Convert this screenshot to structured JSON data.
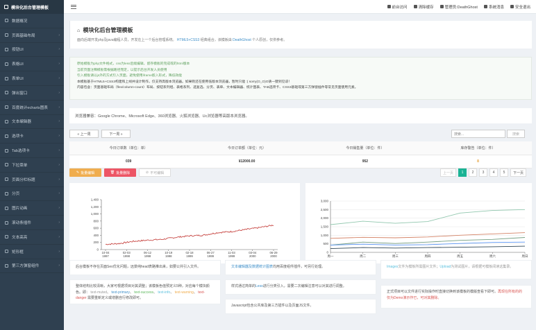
{
  "brand": "模块化后台管理模板",
  "sidebar": {
    "items": [
      {
        "label": "数据概况",
        "arrow": ""
      },
      {
        "label": "页面基础布局",
        "arrow": "›"
      },
      {
        "label": "按钮UI",
        "arrow": "›"
      },
      {
        "label": "表格UI",
        "arrow": "›"
      },
      {
        "label": "表单UI",
        "arrow": "›"
      },
      {
        "label": "弹出窗口",
        "arrow": "›"
      },
      {
        "label": "百度统计echarts图表",
        "arrow": "›"
      },
      {
        "label": "文本编辑器",
        "arrow": "›"
      },
      {
        "label": "选项卡",
        "arrow": "›"
      },
      {
        "label": "Tab选项卡",
        "arrow": "›"
      },
      {
        "label": "下拉菜单",
        "arrow": "›"
      },
      {
        "label": "页面分栏标题",
        "arrow": "›"
      },
      {
        "label": "分页",
        "arrow": "›"
      },
      {
        "label": "图片动画",
        "arrow": "›"
      },
      {
        "label": "滚动条插件",
        "arrow": "›"
      },
      {
        "label": "文本高亮",
        "arrow": "›"
      },
      {
        "label": "矩形框",
        "arrow": "›"
      },
      {
        "label": "第三方弹窗组件",
        "arrow": "›"
      }
    ]
  },
  "topbar": {
    "links": [
      {
        "label": "前台访问",
        "icon": "home-icon"
      },
      {
        "label": "清除缓存",
        "icon": "refresh-icon"
      },
      {
        "label": "管理员:DeathGhost",
        "icon": "user-icon"
      },
      {
        "label": "系统消息",
        "icon": "bell-icon"
      },
      {
        "label": "安全退出",
        "icon": "logout-icon"
      }
    ]
  },
  "header": {
    "title": "模块化后台管理模板",
    "desc_before": "面向后端开发php及java编程人员，开发在上一个后台管理系统。",
    "desc_hl1": "HTML5+CSS3",
    "desc_mid": "经典组合，该模板由",
    "desc_hl2": "DeathGhost",
    "desc_after": "个人原创，仅供参考。"
  },
  "notice": {
    "lines": [
      {
        "text": "原始模板为php文件格式，css为less后缀编辑，留存模板的完成或的html版本",
        "cls": "g"
      },
      {
        "text": "当前页面注释模板需根据路径而定，以提示后台开发人员使用",
        "cls": "g"
      },
      {
        "text": "引入模板请以js外的方式引入页面，避免使用iframe嵌入形式，降低效能",
        "cls": "g"
      },
      {
        "text": "本模板基于HTML5+CSS3构建和上线并设计制作，仅支持高版本浏览器。如果则还在使用低版本浏览器，暂时只能 :( sorry(O_O)O请一键到见谅！",
        "cls": "d"
      },
      {
        "text": "内容包含：页面基础布局（flex/column-count）布局、按钮系列组、表格系列、选复选、分页、表单、文本编辑器、统计图表、TAB选项卡、CSS3基础或第三方弹窗插件等常见页面使用元素。",
        "cls": "d"
      }
    ]
  },
  "browsers": "浏览器兼容：Google Chrome、Microsoft Edge、360浏览器、火狐浏览器、Uc浏览器等高版本浏览器。",
  "toolbar": {
    "prev": "« 上一周",
    "next": "下一周 »",
    "search_placeholder": "搜索...",
    "search_btn": "搜索"
  },
  "stats": {
    "headers": [
      "今日订单数（单位：单）",
      "今日订单额（单位：元）",
      "今日销售量（单位：件）",
      "库存警告（单位：件）"
    ],
    "values": [
      "039",
      "¥12000.00",
      "952",
      "8"
    ]
  },
  "actions": {
    "batch_edit": "批量编辑",
    "batch_delete": "批量删除",
    "no_edit": "不可编辑"
  },
  "pagination": {
    "prev": "上一页",
    "pages": [
      "1",
      "2",
      "3",
      "4",
      "5"
    ],
    "active": "1",
    "next": "下一页"
  },
  "chart_data": [
    {
      "type": "line",
      "title": "",
      "xlabel": "",
      "ylabel": "",
      "x": [
        "10-04 1997",
        "02-03 1998",
        "06-12 1998",
        "10-19 1998",
        "02-18 1999",
        "06-27 1999",
        "11-03 1999",
        "03-04 2000",
        "06-29 2000"
      ],
      "ylim": [
        0,
        1400
      ],
      "yticks": [
        0,
        200,
        400,
        600,
        800,
        1000,
        1200,
        1400
      ],
      "series": [
        {
          "values": [
            148,
            170,
            232,
            264,
            285,
            342,
            385,
            405,
            475,
            505,
            562,
            618,
            688
          ]
        }
      ],
      "colors": [
        "#c23531"
      ],
      "grid": false
    },
    {
      "type": "line",
      "title": "",
      "xlabel": "",
      "ylabel": "",
      "categories": [
        "周一",
        "周二",
        "周三",
        "周四",
        "周五",
        "周六",
        "周日"
      ],
      "ylim": [
        0,
        3000
      ],
      "yticks": [
        0,
        500,
        1000,
        1500,
        2000,
        2500,
        3000
      ],
      "series": [
        {
          "values": [
            1620,
            1820,
            1700,
            1800,
            2300,
            2450,
            2500
          ],
          "color": "#91c7ae"
        },
        {
          "values": [
            820,
            880,
            850,
            900,
            1000,
            1080,
            1150
          ],
          "color": "#d48265"
        },
        {
          "values": [
            420,
            600,
            520,
            600,
            700,
            760,
            870
          ],
          "color": "#749f83"
        },
        {
          "values": [
            420,
            480,
            430,
            450,
            520,
            580,
            600
          ],
          "color": "#5793f3"
        },
        {
          "values": [
            220,
            280,
            250,
            280,
            300,
            330,
            360
          ],
          "color": "#2f4554"
        }
      ],
      "grid": true
    }
  ],
  "info": {
    "box1": "后台模板不存在页面Seo优化问题，远景纯head表路推出来，如要公共引入文件。",
    "box2_a": "文本编辑器及数据统计图表",
    "box2_b": "均用百度组件插件，可另行处理。",
    "box3_a": "Images",
    "box3_b": "文件为模板所需图片文件；",
    "box3_c": "Upload",
    "box3_d": "为测试图片，请根据可模板阅读这集录。",
    "box4_a": "整体结构比较清晰，大家可根据项目对其调整；该模板色值预定义5种，对应每个模块颜色。即：",
    "box4_c1": "text-muted",
    "box4_c2": "text-primary",
    "box4_c3": "text-success",
    "box4_c4": "text-info",
    "box4_c5": "text-warning",
    "box4_c6": "text-danger",
    "box4_b": "需要重新定义或增删自行修改即可。",
    "box5_a": "样式通过简单的",
    "box5_hl": "Less",
    "box5_b": "进行分类引入，需要二次编辑注意可以对其进行调整。",
    "box6": "Javascript包含公共库及第三方插件以及页面JS文件。",
    "box7_a": "正式项目可以文件进行实际操作时直接切换到该模板的模版查看下即可。",
    "box7_b": "再现在所有的的仅为Demo演示作已，可对其删除。"
  }
}
